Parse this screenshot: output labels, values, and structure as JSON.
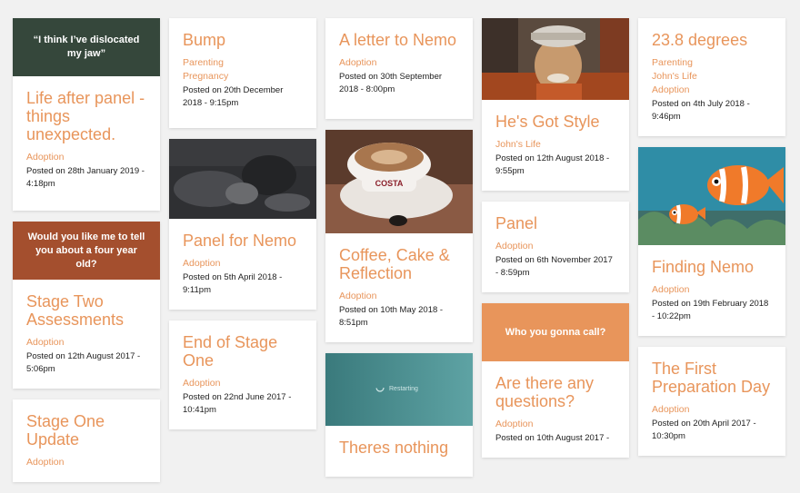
{
  "colors": {
    "accent": "#e8955b",
    "banner_green": "#35473b",
    "banner_rust": "#a44f2e",
    "banner_orange": "#e8955b"
  },
  "columns": [
    [
      {
        "banner": "“I think I’ve dislocated my jaw”",
        "banner_color": "#35473b",
        "title": "Life after panel - things unexpected.",
        "categories": [
          "Adoption"
        ],
        "posted": "Posted on 28th January 2019 - 4:18pm"
      },
      {
        "banner": "Would you like me to tell you about a four year old?",
        "banner_color": "#a44f2e",
        "title": "Stage Two Assessments",
        "categories": [
          "Adoption"
        ],
        "posted": "Posted on 12th August 2017 - 5:06pm"
      },
      {
        "title": "Stage One Update",
        "categories": [
          "Adoption"
        ],
        "posted": ""
      }
    ],
    [
      {
        "title": "Bump",
        "categories": [
          "Parenting",
          "Pregnancy"
        ],
        "posted": "Posted on 20th December 2018 - 9:15pm"
      },
      {
        "image": "dark-photo",
        "title": "Panel for Nemo",
        "categories": [
          "Adoption"
        ],
        "posted": "Posted on 5th April 2018 - 9:11pm"
      },
      {
        "title": "End of Stage One",
        "categories": [
          "Adoption"
        ],
        "posted": "Posted on 22nd June 2017 - 10:41pm"
      }
    ],
    [
      {
        "title": "A letter to Nemo",
        "categories": [
          "Adoption"
        ],
        "posted": "Posted on 30th September 2018 - 8:00pm"
      },
      {
        "image": "coffee-photo",
        "image_text": "COSTA",
        "title": "Coffee, Cake & Reflection",
        "categories": [
          "Adoption"
        ],
        "posted": "Posted on 10th May 2018 - 8:51pm"
      },
      {
        "image": "restarting-screen",
        "image_text": "Restarting",
        "title": "Theres nothing",
        "categories": [],
        "posted": ""
      }
    ],
    [
      {
        "image": "man-photo",
        "title": "He's Got Style",
        "categories": [
          "John's Life"
        ],
        "posted": "Posted on 12th August 2018 - 9:55pm"
      },
      {
        "title": "Panel",
        "categories": [
          "Adoption"
        ],
        "posted": "Posted on 6th November 2017 - 8:59pm"
      },
      {
        "banner": "Who you gonna call?",
        "banner_color": "#e8955b",
        "title": "Are there any questions?",
        "categories": [
          "Adoption"
        ],
        "posted": "Posted on 10th August 2017 -"
      }
    ],
    [
      {
        "title": "23.8 degrees",
        "categories": [
          "Parenting",
          "John's Life",
          "Adoption"
        ],
        "posted": "Posted on 4th July 2018 - 9:46pm"
      },
      {
        "image": "nemo-illustration",
        "title": "Finding Nemo",
        "categories": [
          "Adoption"
        ],
        "posted": "Posted on 19th February 2018 - 10:22pm"
      },
      {
        "title": "The First Preparation Day",
        "categories": [
          "Adoption"
        ],
        "posted": "Posted on 20th April 2017 - 10:30pm"
      }
    ]
  ]
}
